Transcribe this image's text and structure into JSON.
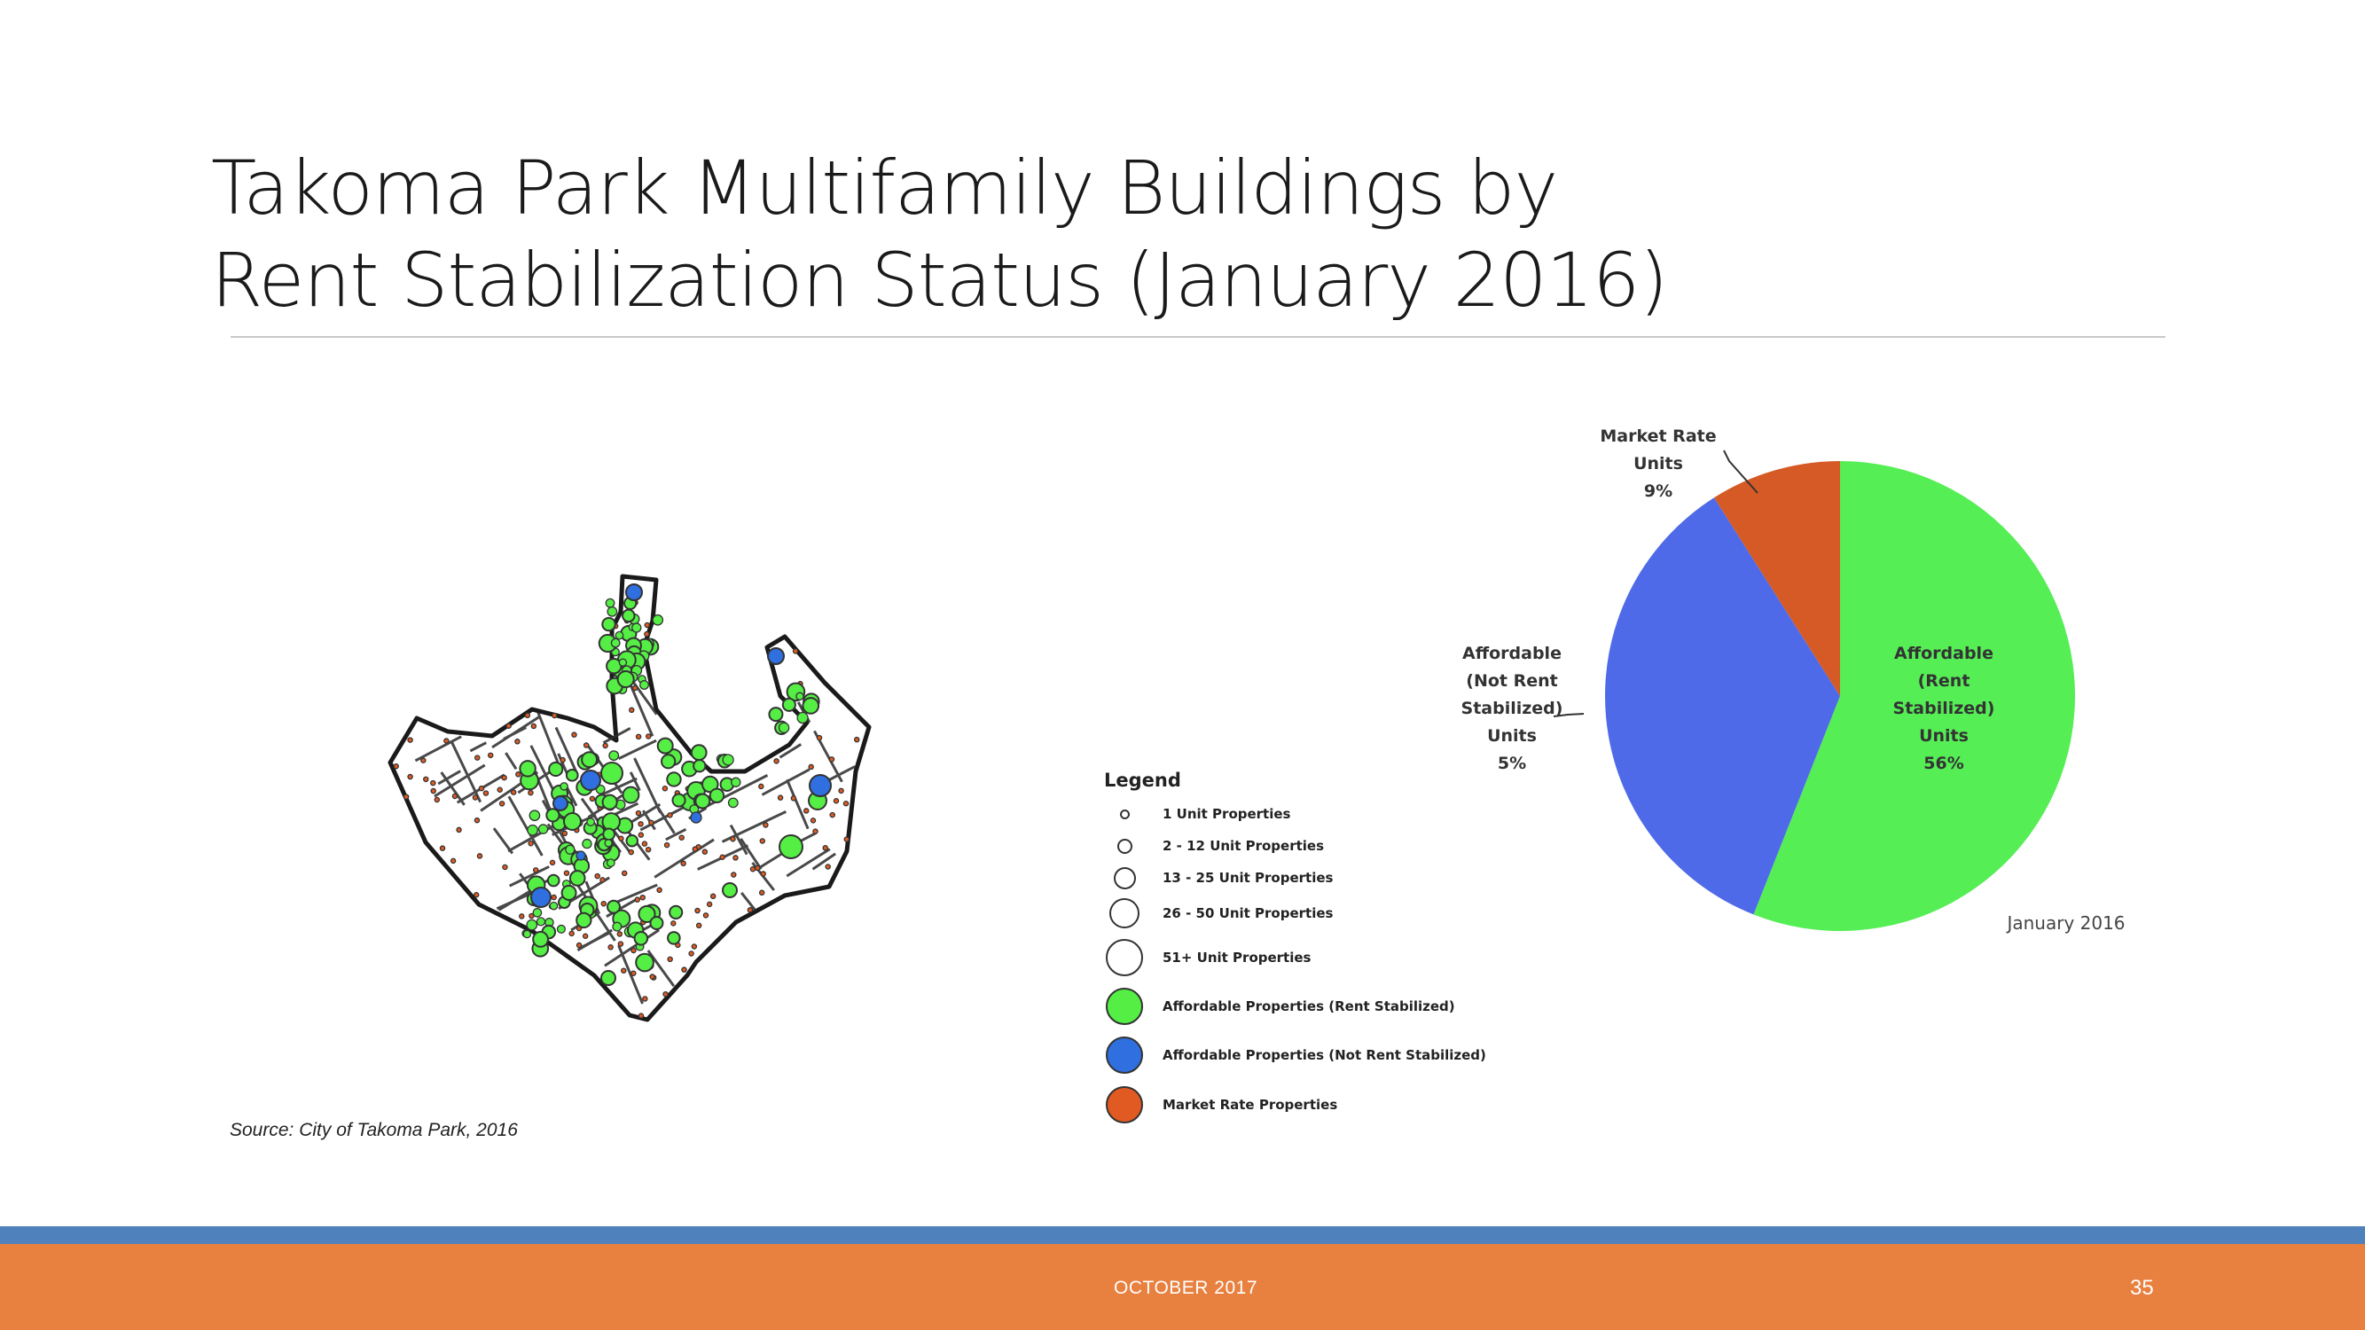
{
  "slide": {
    "title_line1": "Takoma Park Multifamily Buildings by",
    "title_line2": "Rent Stabilization Status (January 2016)",
    "source": "Source: City of Takoma Park, 2016",
    "footer_date": "OCTOBER 2017",
    "page_number": "35"
  },
  "legend": {
    "title": "Legend",
    "items": [
      {
        "label": "1 Unit Properties",
        "icon": "circle-xs-outline"
      },
      {
        "label": "2 - 12 Unit Properties",
        "icon": "circle-s-outline"
      },
      {
        "label": "13 - 25 Unit Properties",
        "icon": "circle-m-outline"
      },
      {
        "label": "26 - 50 Unit Properties",
        "icon": "circle-l-outline"
      },
      {
        "label": "51+ Unit Properties",
        "icon": "circle-xl-outline"
      },
      {
        "label": "Affordable Properties (Rent Stabilized)",
        "icon": "circle-green",
        "color": "#55ee44"
      },
      {
        "label": "Affordable Properties (Not Rent Stabilized)",
        "icon": "circle-blue",
        "color": "#2f6fe0"
      },
      {
        "label": "Market Rate Properties",
        "icon": "circle-orange",
        "color": "#e05a22"
      }
    ]
  },
  "pie": {
    "date_label": "January 2016",
    "labels": {
      "market_rate": [
        "Market Rate",
        "Units",
        "9%"
      ],
      "not_stabilized": [
        "Affordable",
        "(Not Rent",
        "Stabilized)",
        "Units",
        "5%"
      ],
      "stabilized": [
        "Affordable",
        "(Rent",
        "Stabilized)",
        "Units",
        "56%"
      ]
    }
  },
  "chart_data": {
    "type": "pie",
    "title": "",
    "categories": [
      "Affordable (Rent Stabilized) Units",
      "Affordable (Not Rent Stabilized) Units",
      "Market Rate Units"
    ],
    "printed_percent_labels": [
      "56%",
      "5%",
      "9%"
    ],
    "approx_slice_shares": [
      0.56,
      0.35,
      0.09
    ],
    "colors": [
      "#55ee55",
      "#4f6ae8",
      "#d65a25"
    ]
  },
  "colors": {
    "accent_blue": "#4f81bd",
    "accent_orange": "#e8803f",
    "green": "#55ee44",
    "blue": "#2f6fe0",
    "orange": "#e05a22"
  }
}
